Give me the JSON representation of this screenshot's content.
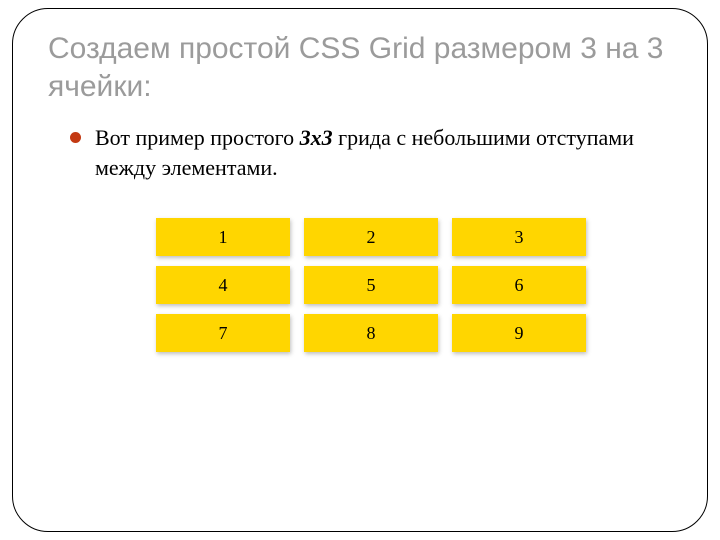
{
  "title": "Создаем простой CSS Grid размером 3 на 3 ячейки:",
  "bullet": {
    "pre": "Вот пример простого ",
    "em": "3x3",
    "post": " грида с небольшими отступами между элементами."
  },
  "grid": {
    "cells": [
      "1",
      "2",
      "3",
      "4",
      "5",
      "6",
      "7",
      "8",
      "9"
    ]
  }
}
